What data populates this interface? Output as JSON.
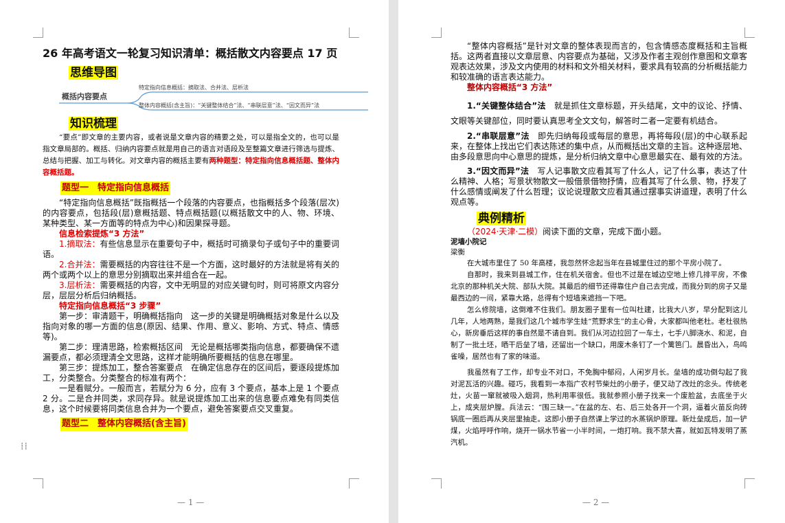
{
  "page1": {
    "title": "26 年高考语文一轮复习知识清单：概括散文内容要点 17 页",
    "mindmap_header": "思维导图",
    "mindmap": {
      "root": "概括内容要点",
      "branch1": "特定指向信息概括：摘取法、合并法、层析法",
      "branch2": "整体内容概括(含主旨)：“关键整体结合”法、“串联层意”法、“因文而异”法"
    },
    "knowledge_header": "知识梳理",
    "intro": "“要点”即文章的主要内容，或者说是文章内容的精要之处，可以是指全文的，也可以是指文章局部的。概括、归纳内容要点就是用自己的语言对语段及至整篇文章进行筛选与提炼、总结与把握、加工与转化。对文章内容的概括主要有",
    "intro_red": "两种题型：特定指向信息概括题、整体内容概括题。",
    "type1_title": "题型一　特定指向信息概括",
    "type1_para": "“特定指向信息概括”既指概括一个段落的内容要点，也指概括多个段落(层次)的内容要点，包括段(层)意概括题、特点概括题(以概括散文中的人、物、环境、某种类型、某一方面等的特点为中心)和因果探寻题。",
    "methods_title": "信息检索提炼“3 方法”",
    "m1_label": "1.摘取法：",
    "m1_text": "有些信息显示在重要句子中，概括时可摘录句子或句子中的重要词语。",
    "m2_label": "2.合并法：",
    "m2_text": "需要概括的内容往往不是一个方面，这时最好的方法就是将有关的两个或两个以上的意思分别摘取出来并组合在一起。",
    "m3_label": "3.层析法：",
    "m3_text": "需要概括的内容，文中无明显的对应关键句时，则可将原文内容分层，层层分析后归纳概括。",
    "steps_title": "特定指向信息概括“3 步骤”",
    "step1": "第一步：审清题干，明确概括指向　这一步的关键是明确概括对象是什么以及指向对象的哪一方面的信息(原因、结果、作用、意义、影响、方式、特点、情感等)。",
    "step2": "第二步：理清思路，检索概括区间　无论是概括哪类指向信息，都要确保不遗漏要点，都必须理清全文思路，这样才能明确所要概括的信息在哪里。",
    "step3": "第三步：提炼加工，整合答案要点　在确定信息存在的区间后，要逐段提炼加工，分类整合。分类整合的标准有两个：",
    "step3b": "一是看赋分。一般而言，若赋分为 6 分，应有 3 个要点，基本上是 1 个要点 2 分。二是合并同类，求同存异。就是说提炼加工出来的信息要点难免有同类信息，这个时候要将同类信息合并为一个要点，避免答案要点交叉重复。",
    "type2_title": "题型二　整体内容概括(含主旨)",
    "page_number": "— 1 —"
  },
  "page2": {
    "para1": "“整体内容概括”是针对文章的整体表现而言的，包含情感态度概括和主旨概括。这两者直接以文章层意、内容要点为基础，又涉及作者主观创作意图和文章客观表达效果，涉及文内使用的材料和文外相关材料，要求具有较高的分析概括能力和较准确的语言表达能力。",
    "methods_title": "整体内容概括“3 方法”",
    "m1_label": "1.“关键整体结合”法",
    "m1_text": "　就是抓住文章标题，开头结尾，文中的议论、抒情、文眼等关键部位，同时要认真思考全文文句，解答时二者一定要有机结合。",
    "m2_label": "2.“串联层意”法",
    "m2_text": "　即先归纳每段或每层的意思，再将每段(层)的中心联系起来，在整体上找出它们表达陈述的集中点，从而概括出文章的主旨。这种逐层地、由多段意思向中心意思的提炼，是分析归纳文章中心意思最实在、最有效的方法。",
    "m3_label": "3.“因文而异”法",
    "m3_text": "　写人记事散文应看其写了什么人，记了什么事，表达了什么精神、人格；写景状物散文一般借景借物抒情，应看其写了什么景、物，抒发了什么感情或阐发了什么哲理；议论说理散文应看其通过摆事实讲道理，表明了什么观点等。",
    "example_header": "典例精析",
    "source": "（2024·天津·二模）",
    "instruction": "阅读下面的文章，完成下面小题。",
    "story_title": "泥墙小院记",
    "author": "梁衡",
    "s1": "在大城市里住了 50 年高楼，我忽然怀念起当年在县城里住过的那个平房小院了。",
    "s2": "自那时，我来到县城工作，住在机关宿舍。但也不过是在城边空地上修几排平房，不像北京的那种机关大院、部队大院。其最后的细节还得靠住户自己去完成，而我分到的房子又是最西边的一间，紧靠大路，总得有个短墙来遮挡一下吧。",
    "s3": "怎么修院墙，这倒难不住我们。朋友圈子里有一位叫杜建，比我大八岁，早分配到这儿几年，人地两熟，是我们这几个城市学生娃“荒野求生”的主心骨，大家都叫他老杜。老杜很热心，新房垂后这样的事自然是不请自到。我们从河边拉回了一车土，七手八脚浇水、和泥，自制了一批土坯，晒干后垒了墙，还留出一个缺口，用废木条钉了一个篱笆门。晨昏出入，鸟鸣雀噪，居然也有了家的味道。",
    "s4": "我虽然有了工作，却专业不对口，不免胸中郁闷，人闲岁月长。垒墙的成功倒勾起了我对泥瓦活的兴趣。碰巧，我看到一本指广农村节柴灶的小册子，便又动了改灶的念头。传统老灶，火苗一窜就被吸入烟洞，热利用率很低。我就参照小册子找来一个废脸盆，去底坐于火上，成夹层炉膛。兵法云：“围三缺一。”在盆的左、右、后三处各开一个洞，逼着火苗反向砖锅底一圈后再从夹层里抽走。这即小册子自然课上学过的水蒸锅炉原理。新灶垒成后，加一铲煤，火焰呼呼作响，烧开一锅水节省一小半时间，一炮打响。我不禁大喜，就如瓦特发明了蒸汽机。",
    "page_number": "— 2 —"
  }
}
